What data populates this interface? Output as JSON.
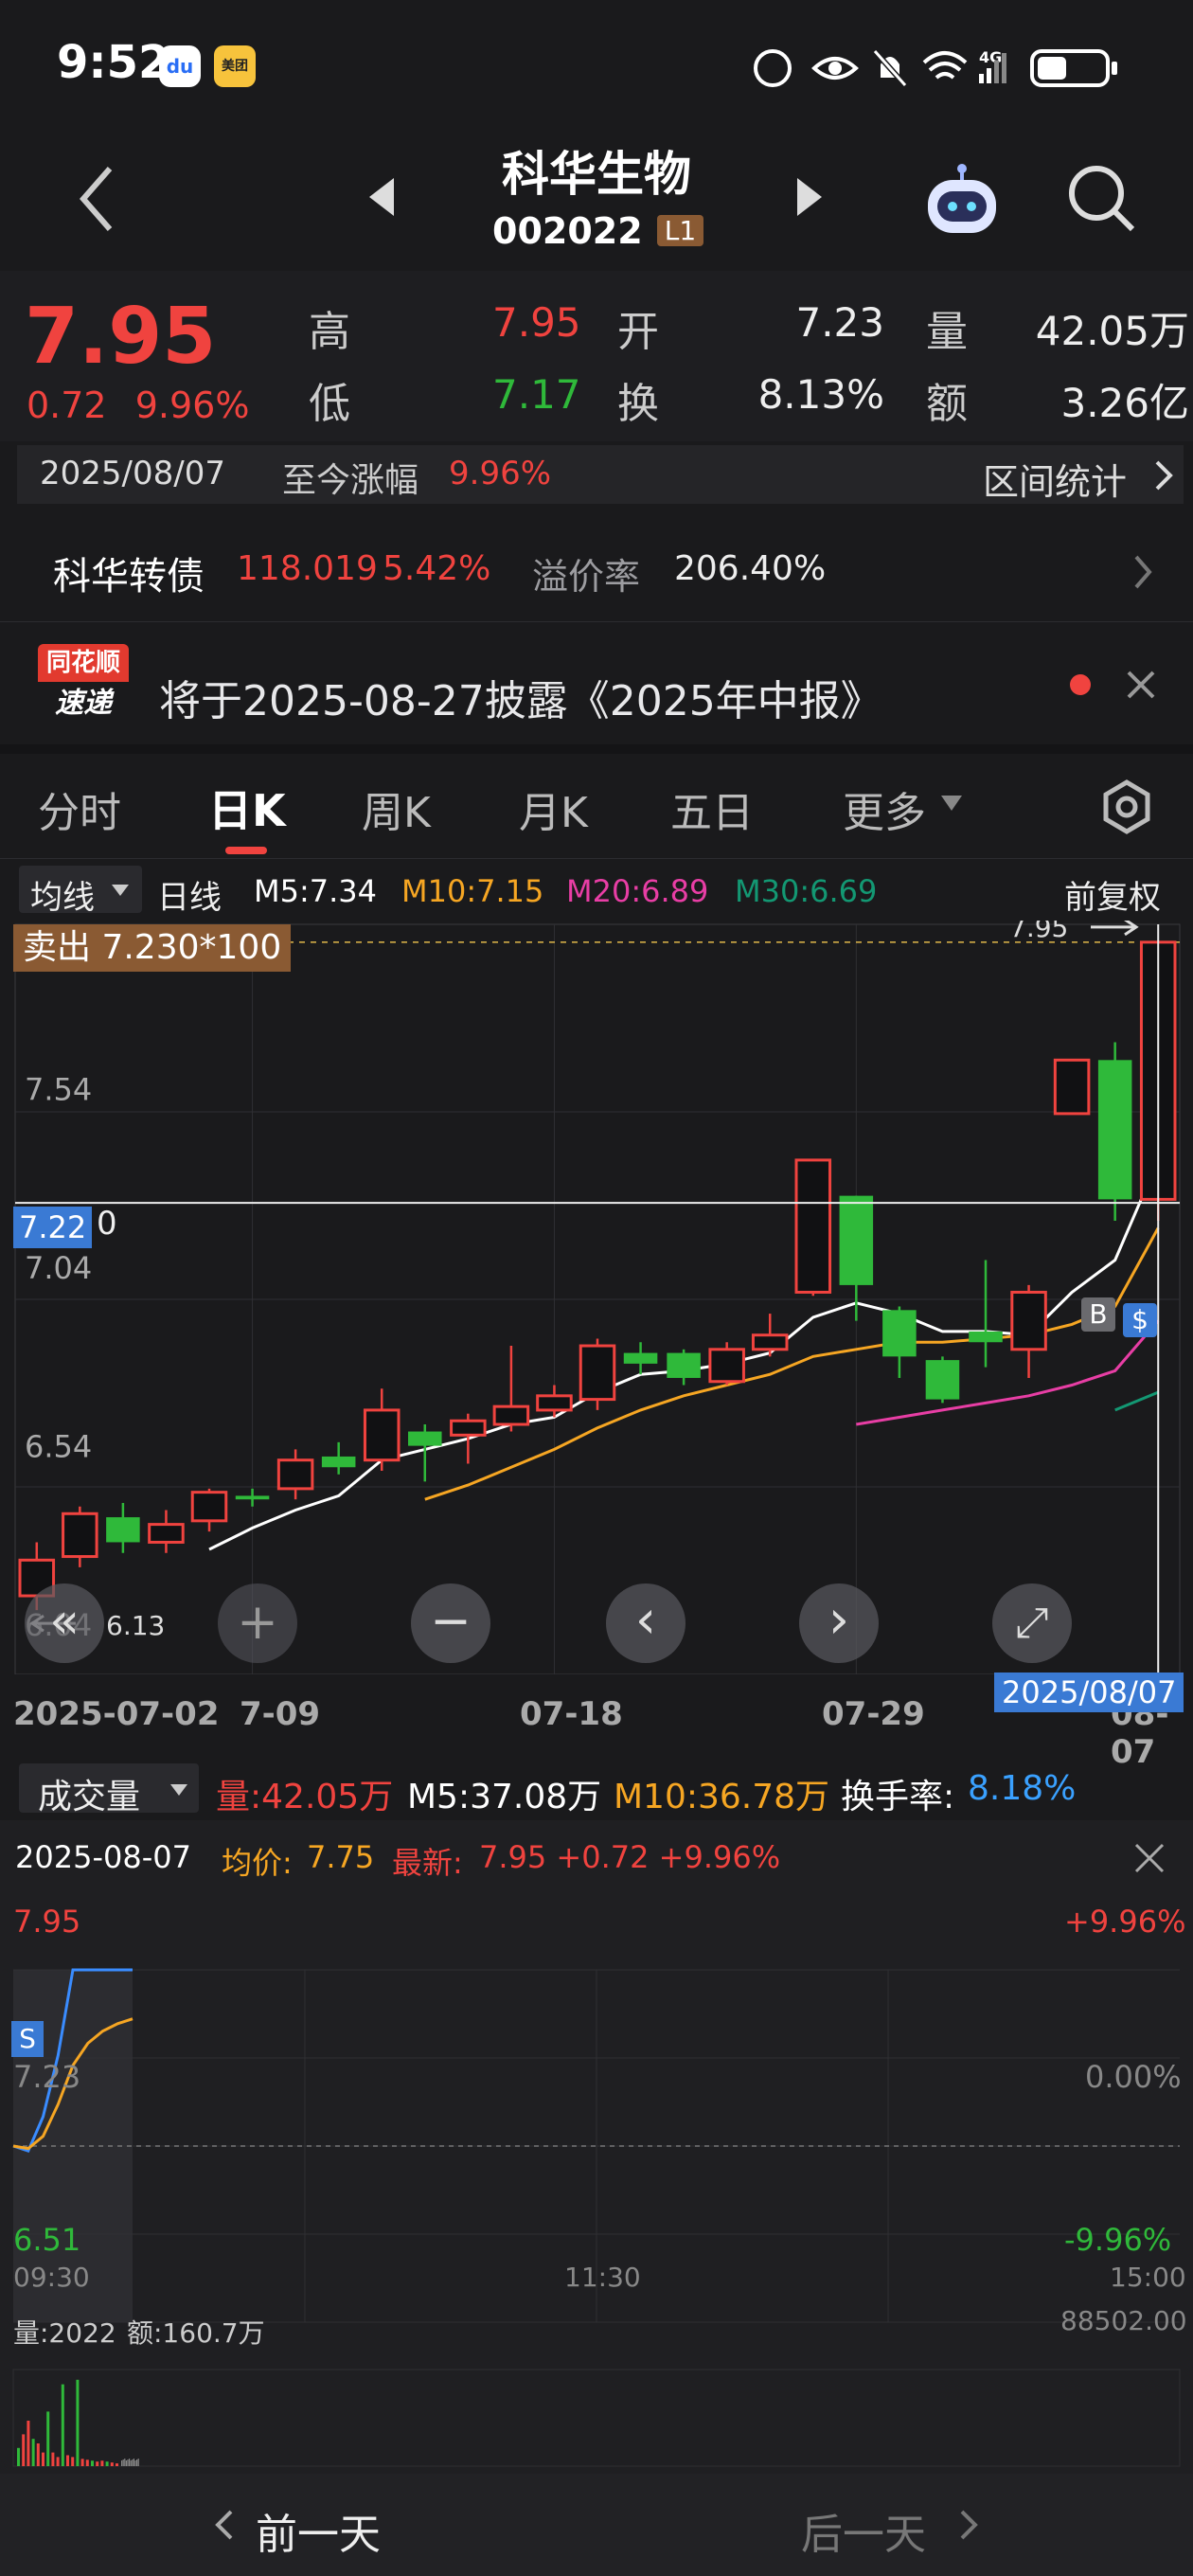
{
  "status_bar": {
    "time": "9:52",
    "network": "4G",
    "signal": "6"
  },
  "header": {
    "name": "科华生物",
    "code": "002022",
    "level_badge": "L1"
  },
  "quote": {
    "price": "7.95",
    "change": "0.72",
    "change_pct": "9.96%",
    "high_label": "高",
    "high": "7.95",
    "low_label": "低",
    "low": "7.17",
    "open_label": "开",
    "open": "7.23",
    "turnover_label": "换",
    "turnover": "8.13%",
    "volume_label": "量",
    "volume": "42.05万",
    "amount_label": "额",
    "amount": "3.26亿"
  },
  "range_row": {
    "date": "2025/08/07",
    "label": "至今涨幅",
    "value": "9.96%",
    "stats": "区间统计"
  },
  "bond_row": {
    "name": "科华转债",
    "price": "118.019",
    "pct": "5.42%",
    "premium_label": "溢价率",
    "premium": "206.40%"
  },
  "notice": {
    "logo_top": "同花顺",
    "logo_bottom": "速递",
    "text": "将于2025-08-27披露《2025年中报》"
  },
  "tabs": [
    "分时",
    "日K",
    "周K",
    "月K",
    "五日",
    "更多"
  ],
  "active_tab": 1,
  "ma_bar": {
    "selector": "均线",
    "period": "日线",
    "m5": "M5:7.34",
    "m10": "M10:7.15",
    "m20": "M20:6.89",
    "m30": "M30:6.69",
    "adjust": "前复权",
    "colors": {
      "m5": "#ffffff",
      "m10": "#f6a623",
      "m20": "#e83ea5",
      "m30": "#139873"
    }
  },
  "kline": {
    "sell_tag": "卖出 7.230*100",
    "max_label": "7.95",
    "min_label": "6.13",
    "cursor_price": "7.22",
    "cursor_price_tail": "0",
    "y_ticks": [
      "7.54",
      "7.04",
      "6.54",
      "6.04"
    ],
    "x_ticks": [
      "2025-07-02",
      "7-09",
      "07-18",
      "07-29",
      "08-07"
    ],
    "cursor_date": "2025/08/07",
    "marker_b": "B",
    "marker_s": "$"
  },
  "chart_data": {
    "type": "candlestick",
    "ylim": [
      5.9,
      8.0
    ],
    "dates": [
      "07-02",
      "07-03",
      "07-04",
      "07-07",
      "07-08",
      "07-09",
      "07-10",
      "07-11",
      "07-14",
      "07-15",
      "07-16",
      "07-17",
      "07-18",
      "07-21",
      "07-22",
      "07-23",
      "07-24",
      "07-25",
      "07-28",
      "07-29",
      "07-30",
      "07-31",
      "08-01",
      "08-04",
      "08-05",
      "08-06",
      "08-07"
    ],
    "candles": [
      {
        "o": 6.12,
        "c": 6.22,
        "h": 6.27,
        "l": 6.08
      },
      {
        "o": 6.23,
        "c": 6.35,
        "h": 6.37,
        "l": 6.2
      },
      {
        "o": 6.34,
        "c": 6.27,
        "h": 6.38,
        "l": 6.24
      },
      {
        "o": 6.27,
        "c": 6.32,
        "h": 6.36,
        "l": 6.24
      },
      {
        "o": 6.33,
        "c": 6.41,
        "h": 6.42,
        "l": 6.3
      },
      {
        "o": 6.4,
        "c": 6.39,
        "h": 6.42,
        "l": 6.37
      },
      {
        "o": 6.42,
        "c": 6.5,
        "h": 6.53,
        "l": 6.39
      },
      {
        "o": 6.51,
        "c": 6.48,
        "h": 6.55,
        "l": 6.46
      },
      {
        "o": 6.5,
        "c": 6.64,
        "h": 6.7,
        "l": 6.47
      },
      {
        "o": 6.58,
        "c": 6.54,
        "h": 6.6,
        "l": 6.44
      },
      {
        "o": 6.57,
        "c": 6.61,
        "h": 6.63,
        "l": 6.49
      },
      {
        "o": 6.6,
        "c": 6.65,
        "h": 6.82,
        "l": 6.58
      },
      {
        "o": 6.64,
        "c": 6.68,
        "h": 6.71,
        "l": 6.62
      },
      {
        "o": 6.67,
        "c": 6.82,
        "h": 6.84,
        "l": 6.64
      },
      {
        "o": 6.8,
        "c": 6.77,
        "h": 6.83,
        "l": 6.74
      },
      {
        "o": 6.8,
        "c": 6.73,
        "h": 6.81,
        "l": 6.71
      },
      {
        "o": 6.72,
        "c": 6.81,
        "h": 6.83,
        "l": 6.71
      },
      {
        "o": 6.81,
        "c": 6.85,
        "h": 6.91,
        "l": 6.79
      },
      {
        "o": 6.97,
        "c": 7.34,
        "h": 7.34,
        "l": 6.96
      },
      {
        "o": 7.24,
        "c": 6.99,
        "h": 7.24,
        "l": 6.89
      },
      {
        "o": 6.92,
        "c": 6.79,
        "h": 6.93,
        "l": 6.73
      },
      {
        "o": 6.78,
        "c": 6.67,
        "h": 6.79,
        "l": 6.66
      },
      {
        "o": 6.86,
        "c": 6.83,
        "h": 7.06,
        "l": 6.76
      },
      {
        "o": 6.81,
        "c": 6.97,
        "h": 6.99,
        "l": 6.73
      },
      {
        "o": 7.47,
        "c": 7.62,
        "h": 7.62,
        "l": 7.47
      },
      {
        "o": 7.62,
        "c": 7.23,
        "h": 7.67,
        "l": 7.17
      },
      {
        "o": 7.23,
        "c": 7.95,
        "h": 7.95,
        "l": 7.17
      }
    ],
    "series": [
      {
        "name": "M5",
        "color": "#ffffff",
        "values": [
          null,
          null,
          null,
          null,
          6.25,
          6.31,
          6.36,
          6.4,
          6.5,
          6.53,
          6.56,
          6.6,
          6.62,
          6.69,
          6.74,
          6.75,
          6.77,
          6.8,
          6.9,
          6.94,
          6.91,
          6.86,
          6.86,
          6.85,
          6.97,
          7.06,
          7.34
        ]
      },
      {
        "name": "M10",
        "color": "#f6a623",
        "values": [
          null,
          null,
          null,
          null,
          null,
          null,
          null,
          null,
          null,
          6.39,
          6.43,
          6.48,
          6.53,
          6.59,
          6.64,
          6.68,
          6.71,
          6.74,
          6.79,
          6.81,
          6.83,
          6.83,
          6.84,
          6.85,
          6.88,
          6.93,
          7.15
        ]
      },
      {
        "name": "M20",
        "color": "#e83ea5",
        "values": [
          null,
          null,
          null,
          null,
          null,
          null,
          null,
          null,
          null,
          null,
          null,
          null,
          null,
          null,
          null,
          null,
          null,
          null,
          null,
          6.6,
          6.62,
          6.64,
          6.66,
          6.68,
          6.71,
          6.75,
          6.89
        ]
      },
      {
        "name": "M30",
        "color": "#139873",
        "values": [
          null,
          null,
          null,
          null,
          null,
          null,
          null,
          null,
          null,
          null,
          null,
          null,
          null,
          null,
          null,
          null,
          null,
          null,
          null,
          null,
          null,
          null,
          null,
          null,
          null,
          6.64,
          6.69
        ]
      }
    ]
  },
  "nav_buttons": [
    "«",
    "+",
    "−",
    "‹",
    "›",
    "⤢"
  ],
  "volume_bar": {
    "selector": "成交量",
    "vol": "量:42.05万",
    "m5": "M5:37.08万",
    "m10": "M10:36.78万",
    "turnover_label": "换手率:",
    "turnover": "8.18%"
  },
  "intraday": {
    "date": "2025-08-07",
    "avg_label": "均价:",
    "avg": "7.75",
    "latest_label": "最新:",
    "latest": "7.95 +0.72 +9.96%",
    "top_price": "7.95",
    "mid_price": "7.23",
    "bot_price": "6.51",
    "top_pct": "+9.96%",
    "mid_pct": "0.00%",
    "bot_pct": "-9.96%",
    "times": [
      "09:30",
      "11:30",
      "15:00"
    ],
    "s_tag": "S",
    "vol_label": "量:2022",
    "amt_label": "额:160.7万",
    "vol_max": "88502.00",
    "price_line": [
      7.23,
      7.21,
      7.35,
      7.6,
      7.95,
      7.95,
      7.95,
      7.95,
      7.95
    ],
    "avg_line": [
      7.23,
      7.22,
      7.27,
      7.4,
      7.56,
      7.65,
      7.7,
      7.73,
      7.75
    ]
  },
  "footer": {
    "prev": "前一天",
    "next": "后一天"
  }
}
